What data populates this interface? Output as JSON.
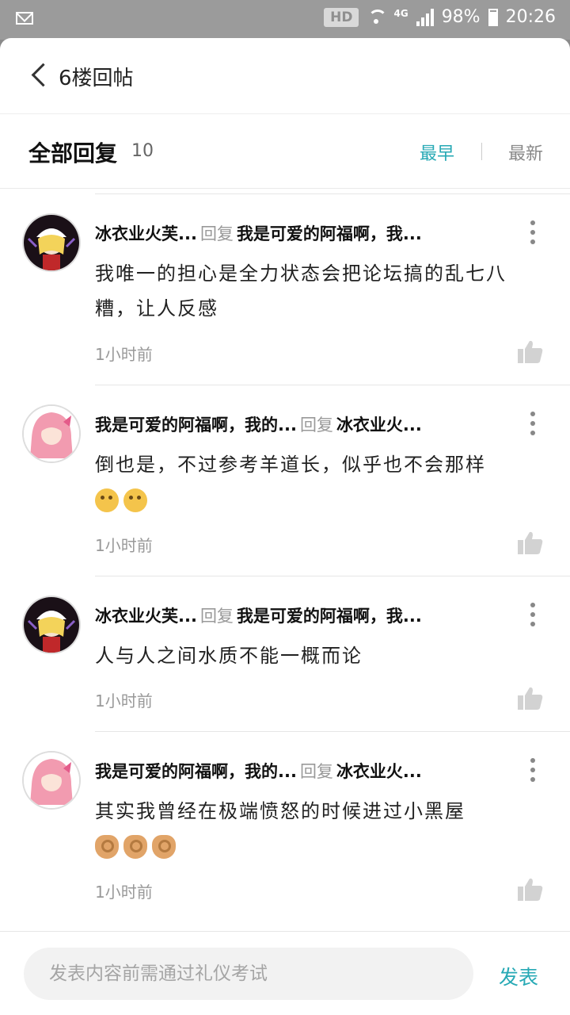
{
  "status_bar": {
    "hd": "HD",
    "network": "4G",
    "battery": "98%",
    "time": "20:26"
  },
  "header": {
    "title": "6楼回帖"
  },
  "filter": {
    "section_title": "全部回复",
    "count": "10",
    "sort_earliest": "最早",
    "sort_latest": "最新"
  },
  "replies": [
    {
      "author": "冰衣业火芙...",
      "reply_word": "回复",
      "target": "我是可爱的阿福啊，我...",
      "content": "我唯一的担心是全力状态会把论坛搞的乱七八糟，让人反感",
      "time": "1小时前",
      "avatar": "flandre"
    },
    {
      "author": "我是可爱的阿福啊，我的...",
      "reply_word": "回复",
      "target": "冰衣业火...",
      "content": "倒也是，不过参考羊道长，似乎也不会那样",
      "emoji": [
        "thinking-face",
        "thinking-face"
      ],
      "time": "1小时前",
      "avatar": "pink-hair"
    },
    {
      "author": "冰衣业火芙...",
      "reply_word": "回复",
      "target": "我是可爱的阿福啊，我...",
      "content": "人与人之间水质不能一概而论",
      "time": "1小时前",
      "avatar": "flandre"
    },
    {
      "author": "我是可爱的阿福啊，我的...",
      "reply_word": "回复",
      "target": "冰衣业火...",
      "content": "其实我曾经在极端愤怒的时候进过小黑屋",
      "emoji": [
        "ok-hand",
        "ok-hand",
        "ok-hand"
      ],
      "time": "1小时前",
      "avatar": "pink-hair"
    }
  ],
  "composer": {
    "placeholder": "发表内容前需通过礼仪考试",
    "publish_label": "发表"
  },
  "colors": {
    "accent": "#27a9b5"
  }
}
